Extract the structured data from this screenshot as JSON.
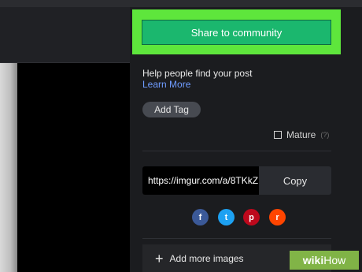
{
  "share": {
    "label": "Share to community"
  },
  "help": {
    "text": "Help people find your post",
    "learn_more": "Learn More"
  },
  "tags": {
    "add_label": "Add Tag"
  },
  "mature": {
    "label": "Mature",
    "help": "(?)"
  },
  "link": {
    "url": "https://imgur.com/a/8TKkZ",
    "copy_label": "Copy"
  },
  "social": {
    "icons": [
      {
        "name": "facebook-icon",
        "glyph": "f",
        "color": "#3b5998"
      },
      {
        "name": "twitter-icon",
        "glyph": "t",
        "color": "#1da1f2"
      },
      {
        "name": "pinterest-icon",
        "glyph": "p",
        "color": "#bd081c"
      },
      {
        "name": "reddit-icon",
        "glyph": "r",
        "color": "#ff4500"
      }
    ]
  },
  "add_images": {
    "label": "Add more images"
  },
  "watermark": {
    "wiki": "wiki",
    "how": "How"
  },
  "colors": {
    "highlight": "#5ee63c",
    "share_button": "#1bb76e",
    "link_text": "#6f9cff"
  }
}
